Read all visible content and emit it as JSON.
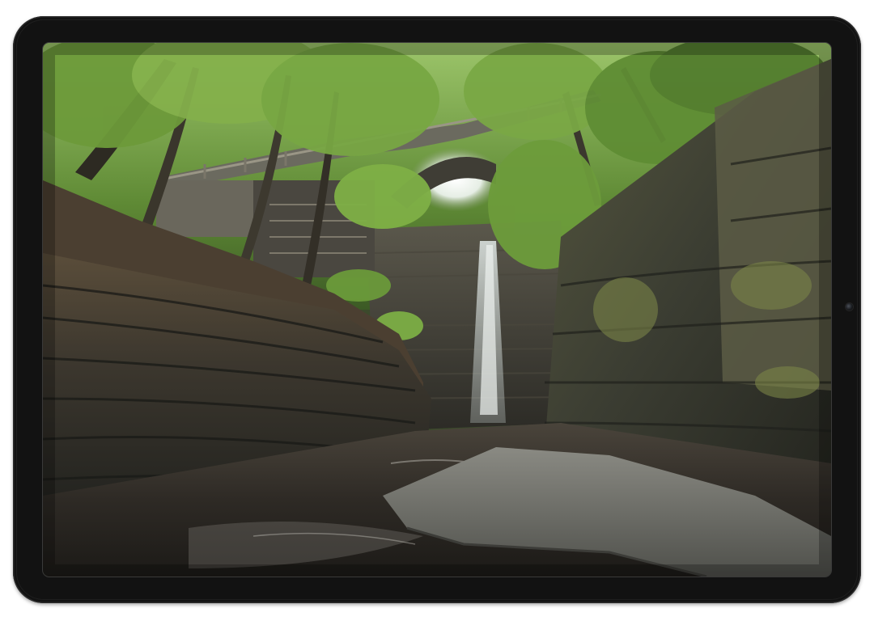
{
  "device": {
    "type": "tablet",
    "orientation": "landscape",
    "bezel_color": "#121212"
  },
  "screen": {
    "content": "photograph",
    "palette": {
      "foliage": "#6f9a3c",
      "sky": "#e9efe9",
      "rock_dark": "#2a2c28",
      "rock_mid": "#4b4d44",
      "water": "#3a3530"
    }
  },
  "icons": {
    "camera": "front-camera-icon"
  }
}
